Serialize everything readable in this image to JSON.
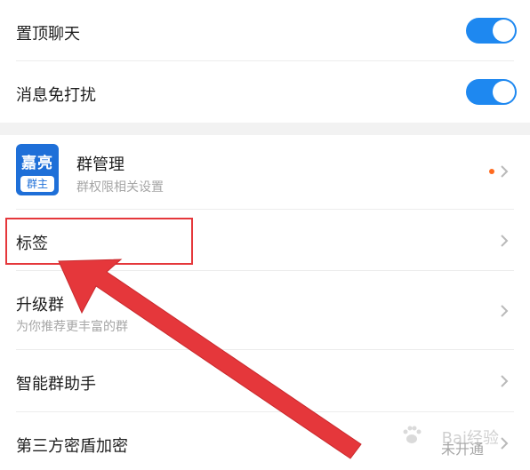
{
  "settings": {
    "pin_chat": {
      "label": "置顶聊天",
      "enabled": true
    },
    "do_not_disturb": {
      "label": "消息免打扰",
      "enabled": true
    }
  },
  "group_manage": {
    "avatar_top": "嘉亮",
    "avatar_badge": "群主",
    "title": "群管理",
    "subtitle": "群权限相关设置",
    "has_notification_dot": true
  },
  "tags": {
    "label": "标签"
  },
  "upgrade_group": {
    "label": "升级群",
    "subtitle": "为你推荐更丰富的群"
  },
  "smart_assistant": {
    "label": "智能群助手"
  },
  "third_party": {
    "label": "第三方密盾加密",
    "status": "未开通"
  },
  "watermark": {
    "text": "Bai经验"
  },
  "colors": {
    "toggle_on": "#1e88f0",
    "annotation_red": "#e5373b",
    "dot": "#ff6a1f"
  },
  "icons": {
    "chevron": "chevron-right-icon",
    "arrow": "annotation-arrow",
    "paw": "paw-icon"
  }
}
